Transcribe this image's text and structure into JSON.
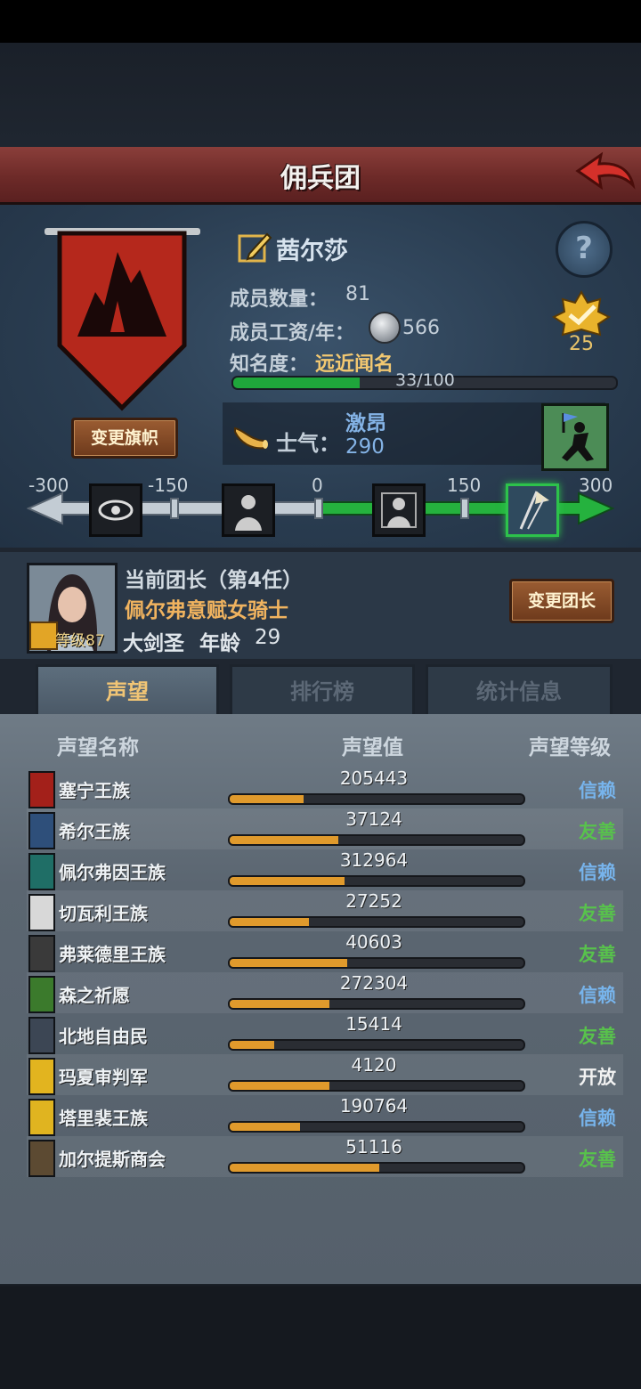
{
  "header": {
    "title": "佣兵团"
  },
  "company": {
    "name": "茜尔莎",
    "change_banner_label": "变更旗帜",
    "members_label": "成员数量：",
    "members_value": "81",
    "wage_label": "成员工资/年：",
    "wage_value": "566",
    "fame_label": "知名度：",
    "fame_rank": "远近闻名",
    "fame_progress_text": "33/100",
    "fame_progress": 0.33,
    "rank_badge_value": "25",
    "banner_color": "#b5281c"
  },
  "morale": {
    "label": "士气：",
    "state": "激昂",
    "value": "290",
    "scale": [
      "-300",
      "-150",
      "0",
      "150",
      "300"
    ]
  },
  "leader": {
    "title": "当前团长（第4任）",
    "name": "佩尔弗意赋女骑士",
    "class": "大剑圣",
    "age_label": "年龄",
    "age": "29",
    "level": "等级87",
    "change_label": "变更团长"
  },
  "tabs": [
    "声望",
    "排行榜",
    "统计信息"
  ],
  "columns": {
    "name": "声望名称",
    "value": "声望值",
    "level": "声望等级"
  },
  "reputations": [
    {
      "name": "塞宁王族",
      "value": "205443",
      "fill": 0.25,
      "level": "信赖",
      "level_type": "trust",
      "icon_color": "#a3201a"
    },
    {
      "name": "希尔王族",
      "value": "37124",
      "fill": 0.37,
      "level": "友善",
      "level_type": "friend",
      "icon_color": "#2e4f7a"
    },
    {
      "name": "佩尔弗因王族",
      "value": "312964",
      "fill": 0.39,
      "level": "信赖",
      "level_type": "trust",
      "icon_color": "#1f6e66"
    },
    {
      "name": "切瓦利王族",
      "value": "27252",
      "fill": 0.27,
      "level": "友善",
      "level_type": "friend",
      "icon_color": "#d8d8d8"
    },
    {
      "name": "弗莱德里王族",
      "value": "40603",
      "fill": 0.4,
      "level": "友善",
      "level_type": "friend",
      "icon_color": "#3a3a3a"
    },
    {
      "name": "森之祈愿",
      "value": "272304",
      "fill": 0.34,
      "level": "信赖",
      "level_type": "trust",
      "icon_color": "#3b7a2c"
    },
    {
      "name": "北地自由民",
      "value": "15414",
      "fill": 0.15,
      "level": "友善",
      "level_type": "friend",
      "icon_color": "#3c4654"
    },
    {
      "name": "玛夏审判军",
      "value": "4120",
      "fill": 0.34,
      "level": "开放",
      "level_type": "open",
      "icon_color": "#e2b41f"
    },
    {
      "name": "塔里裴王族",
      "value": "190764",
      "fill": 0.24,
      "level": "信赖",
      "level_type": "trust",
      "icon_color": "#e0b420"
    },
    {
      "name": "加尔提斯商会",
      "value": "51116",
      "fill": 0.51,
      "level": "友善",
      "level_type": "friend",
      "icon_color": "#5c4a32"
    }
  ]
}
